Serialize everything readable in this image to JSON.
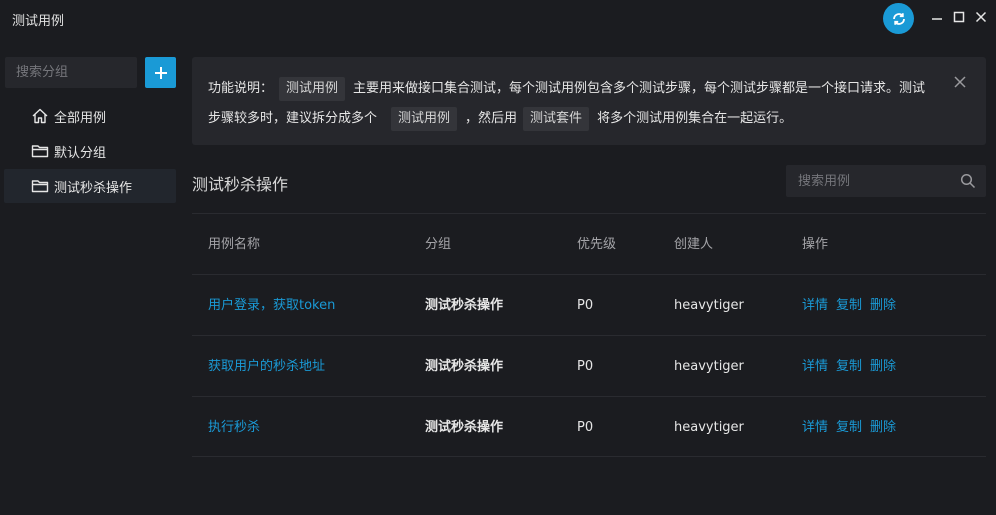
{
  "window": {
    "title": "测试用例"
  },
  "sidebar": {
    "search_placeholder": "搜索分组",
    "items": [
      {
        "label": "全部用例",
        "icon": "home-icon"
      },
      {
        "label": "默认分组",
        "icon": "folder-icon"
      },
      {
        "label": "测试秒杀操作",
        "icon": "folder-icon",
        "active": true
      }
    ]
  },
  "info": {
    "prefix": "功能说明：",
    "tag1": "测试用例",
    "text1": "主要用来做接口集合测试，每个测试用例包含多个测试步骤，每个测试步骤都是一个接口请求。测试步骤较多时，建议拆分成多个",
    "tag2": "测试用例",
    "text2": "，然后用",
    "tag3": "测试套件",
    "text3": "将多个测试用例集合在一起运行。"
  },
  "section": {
    "title": "测试秒杀操作",
    "search_placeholder": "搜索用例"
  },
  "table": {
    "headers": [
      "用例名称",
      "分组",
      "优先级",
      "创建人",
      "操作"
    ],
    "rows": [
      {
        "name": "用户登录，获取token",
        "group": "测试秒杀操作",
        "priority": "P0",
        "creator": "heavytiger"
      },
      {
        "name": "获取用户的秒杀地址",
        "group": "测试秒杀操作",
        "priority": "P0",
        "creator": "heavytiger"
      },
      {
        "name": "执行秒杀",
        "group": "测试秒杀操作",
        "priority": "P0",
        "creator": "heavytiger"
      }
    ],
    "ops": {
      "detail": "详情",
      "copy": "复制",
      "delete": "删除"
    }
  },
  "colors": {
    "accent": "#1a9ad6",
    "background": "#1b1c20",
    "panel": "#26272c"
  }
}
